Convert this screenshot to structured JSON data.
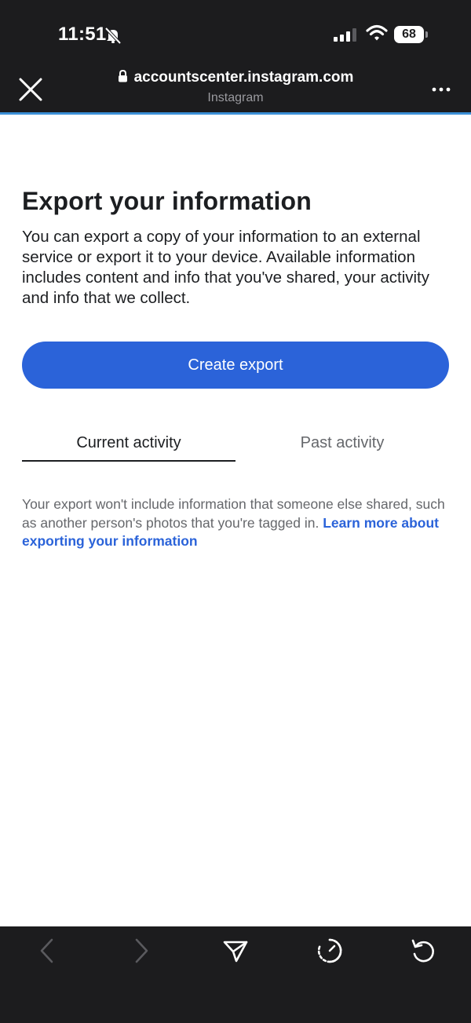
{
  "status_bar": {
    "time": "11:51",
    "battery": "68"
  },
  "browser": {
    "url": "accountscenter.instagram.com",
    "site_name": "Instagram"
  },
  "main": {
    "title": "Export your information",
    "description": "You can export a copy of your information to an external service or export it to your device. Available information includes content and info that you've shared, your activity and info that we collect.",
    "create_button": "Create export",
    "tabs": [
      {
        "label": "Current activity",
        "active": true
      },
      {
        "label": "Past activity",
        "active": false
      }
    ],
    "notice_text": "Your export won't include information that someone else shared, such as another person's photos that you're tagged in.",
    "notice_link": "Learn more about exporting your information"
  },
  "toolbar": {
    "icons": [
      "back-icon",
      "forward-icon",
      "share-icon",
      "speed-icon",
      "reload-icon"
    ]
  },
  "colors": {
    "accent": "#2b63d9",
    "dark_bar": "#1c1c1e",
    "progress": "#3b8fd6"
  }
}
